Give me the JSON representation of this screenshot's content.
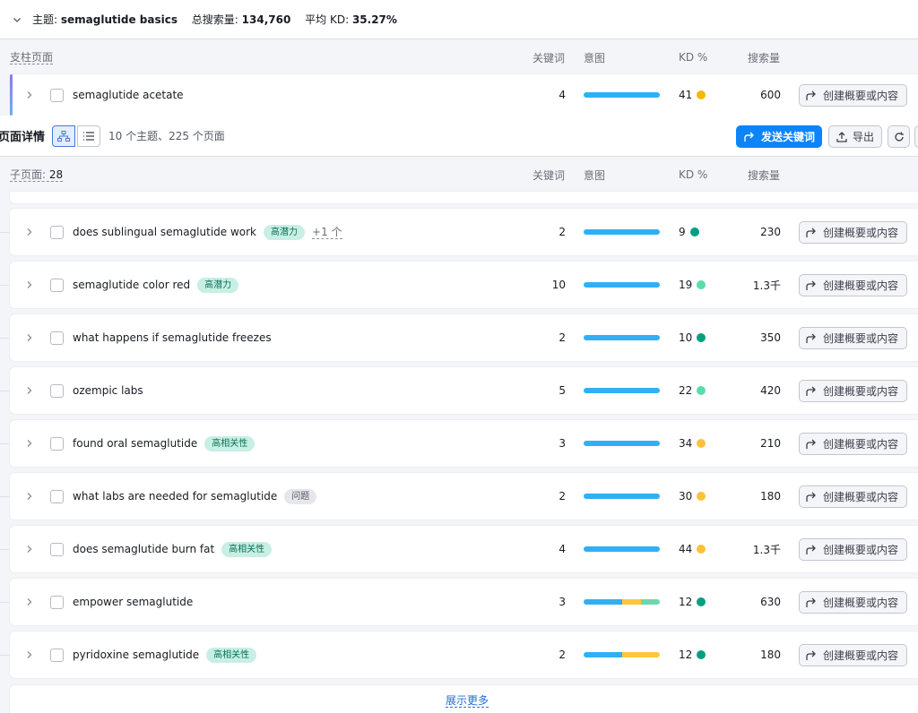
{
  "topic": {
    "label": "主题:",
    "name": "semaglutide basics",
    "total_label": "总搜索量:",
    "total": "134,760",
    "avg_label": "平均 KD:",
    "avg": "35.27%"
  },
  "pillar_header": {
    "first": "支柱页面",
    "keywords": "关键词",
    "intent": "意图",
    "kd": "KD %",
    "volume": "搜索量"
  },
  "pillar_row": {
    "keyword": "semaglutide acetate",
    "count": "4",
    "kd": "41",
    "kd_color": "#f5b800",
    "volume": "600",
    "action": "创建概要或内容"
  },
  "toolbar": {
    "title": "页面详情",
    "summary": "10 个主题、225 个页面",
    "send_label": "发送关键词",
    "export_label": "导出"
  },
  "child_header": {
    "first": "子页面:",
    "count": "28",
    "keywords": "关键词",
    "intent": "意图",
    "kd": "KD %",
    "volume": "搜索量"
  },
  "intent_colors": {
    "blue": "#2fb0f5",
    "yellow": "#fcc73b",
    "green": "#6fd6a8"
  },
  "rows": [
    {
      "keyword": "does sublingual semaglutide work",
      "tag": "高潜力",
      "tag_style": "green",
      "more": "+1 个",
      "count": "2",
      "kd": "9",
      "kd_color": "#009f81",
      "volume": "230",
      "action": "创建概要或内容"
    },
    {
      "keyword": "semaglutide color red",
      "tag": "高潜力",
      "tag_style": "green",
      "more": "",
      "count": "10",
      "kd": "19",
      "kd_color": "#59ddaa",
      "volume": "1.3千",
      "action": "创建概要或内容"
    },
    {
      "keyword": "what happens if semaglutide freezes",
      "tag": "",
      "tag_style": "",
      "more": "",
      "count": "2",
      "kd": "10",
      "kd_color": "#009f81",
      "volume": "350",
      "action": "创建概要或内容"
    },
    {
      "keyword": "ozempic labs",
      "tag": "",
      "tag_style": "",
      "more": "",
      "count": "5",
      "kd": "22",
      "kd_color": "#59ddaa",
      "volume": "420",
      "action": "创建概要或内容"
    },
    {
      "keyword": "found oral semaglutide",
      "tag": "高相关性",
      "tag_style": "green",
      "more": "",
      "count": "3",
      "kd": "34",
      "kd_color": "#fdc23c",
      "volume": "210",
      "action": "创建概要或内容"
    },
    {
      "keyword": "what labs are needed for semaglutide",
      "tag": "问题",
      "tag_style": "gray",
      "more": "",
      "count": "2",
      "kd": "30",
      "kd_color": "#fdc23c",
      "volume": "180",
      "action": "创建概要或内容"
    },
    {
      "keyword": "does semaglutide burn fat",
      "tag": "高相关性",
      "tag_style": "green",
      "more": "",
      "count": "4",
      "kd": "44",
      "kd_color": "#fdc23c",
      "volume": "1.3千",
      "action": "创建概要或内容"
    },
    {
      "keyword": "empower semaglutide",
      "tag": "",
      "tag_style": "",
      "more": "",
      "count": "3",
      "kd": "12",
      "kd_color": "#009f81",
      "volume": "630",
      "action": "创建概要或内容"
    },
    {
      "keyword": "pyridoxine semaglutide",
      "tag": "高相关性",
      "tag_style": "green",
      "more": "",
      "count": "2",
      "kd": "12",
      "kd_color": "#009f81",
      "volume": "180",
      "action": "创建概要或内容"
    }
  ],
  "intent_mix": [
    {
      "blue": 1,
      "yellow": 0,
      "green": 0
    },
    {
      "blue": 1,
      "yellow": 0,
      "green": 0
    },
    {
      "blue": 1,
      "yellow": 0,
      "green": 0
    },
    {
      "blue": 1,
      "yellow": 0,
      "green": 0
    },
    {
      "blue": 1,
      "yellow": 0,
      "green": 0
    },
    {
      "blue": 1,
      "yellow": 0,
      "green": 0
    },
    {
      "blue": 1,
      "yellow": 0,
      "green": 0
    },
    {
      "blue": 0.5,
      "yellow": 0.25,
      "green": 0.25
    },
    {
      "blue": 0.5,
      "yellow": 0.5,
      "green": 0
    }
  ],
  "show_more": "展示更多"
}
